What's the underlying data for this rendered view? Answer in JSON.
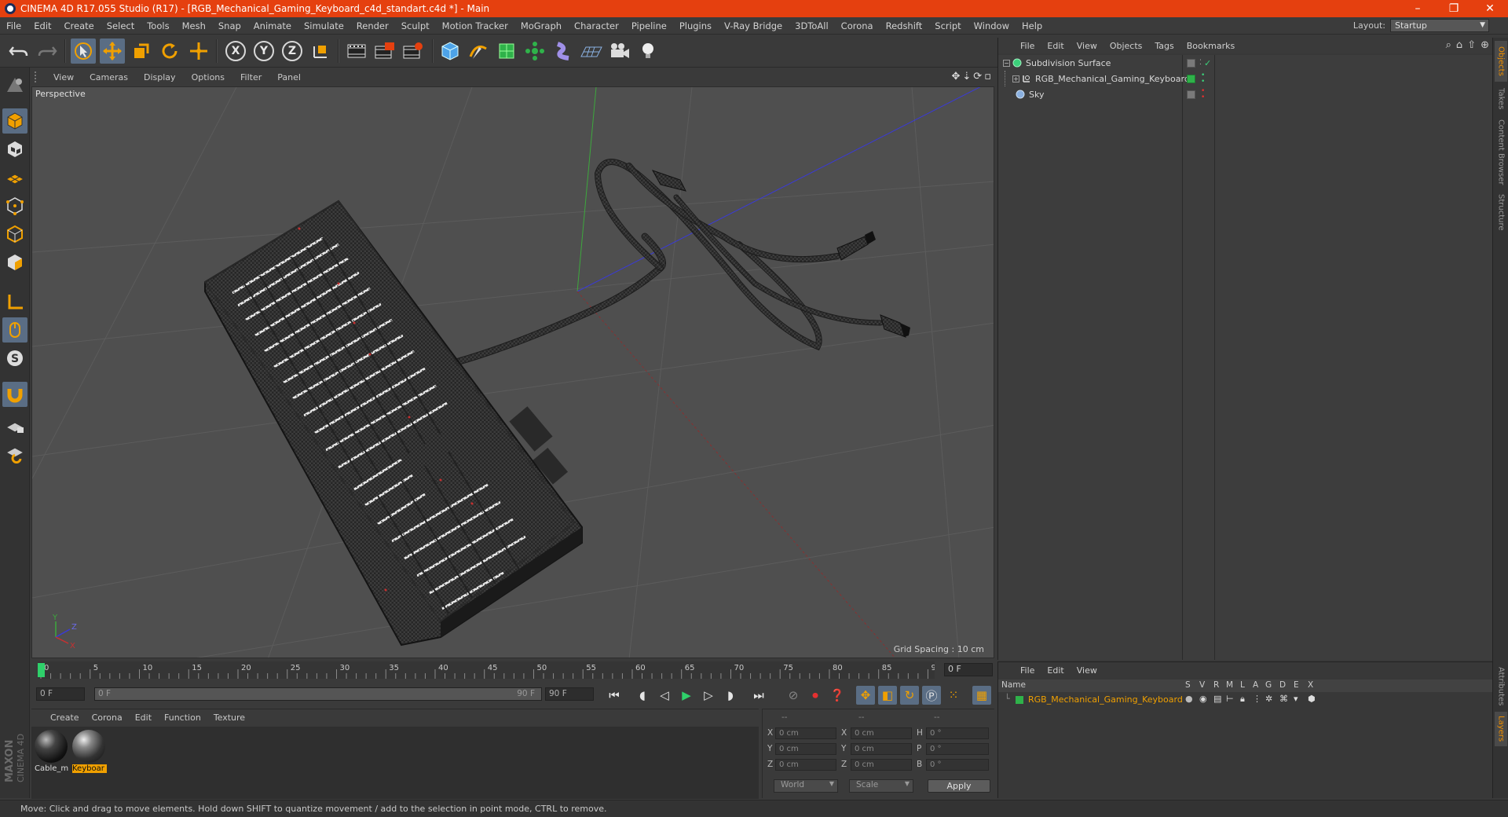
{
  "window": {
    "title": "CINEMA 4D R17.055 Studio (R17) - [RGB_Mechanical_Gaming_Keyboard_c4d_standart.c4d *] - Main",
    "controls": [
      "–",
      "❐",
      "✕"
    ]
  },
  "menubar": {
    "items": [
      "File",
      "Edit",
      "Create",
      "Select",
      "Tools",
      "Mesh",
      "Snap",
      "Animate",
      "Simulate",
      "Render",
      "Sculpt",
      "Motion Tracker",
      "MoGraph",
      "Character",
      "Pipeline",
      "Plugins",
      "V-Ray Bridge",
      "3DToAll",
      "Corona",
      "Redshift",
      "Script",
      "Window",
      "Help"
    ],
    "layout_label": "Layout:",
    "layout_value": "Startup"
  },
  "toolbar": {
    "axis_x": "X",
    "axis_y": "Y",
    "axis_z": "Z",
    "icons": [
      "undo-icon",
      "redo-icon",
      "select-icon",
      "move-icon",
      "scale-icon",
      "rotate-icon",
      "live-select-icon",
      "x-axis-icon",
      "y-axis-icon",
      "z-axis-icon",
      "world-coord-icon",
      "render-view-icon",
      "render-picture-viewer-icon",
      "render-settings-icon",
      "cube-icon",
      "spline-pen-icon",
      "subdivision-icon",
      "array-icon",
      "deformer-icon",
      "floor-icon",
      "camera-icon",
      "light-icon"
    ]
  },
  "viewport": {
    "menu": [
      "View",
      "Cameras",
      "Display",
      "Options",
      "Filter",
      "Panel"
    ],
    "label": "Perspective",
    "grid_spacing": "Grid Spacing : 10 cm",
    "axis_labels": {
      "y": "Y",
      "z": "Z",
      "x": "X"
    }
  },
  "timeline": {
    "ticks": [
      "0",
      "5",
      "10",
      "15",
      "20",
      "25",
      "30",
      "35",
      "40",
      "45",
      "50",
      "55",
      "60",
      "65",
      "70",
      "75",
      "80",
      "85",
      "90"
    ],
    "current_frame": "0 F",
    "start_frame": "0 F",
    "range_start": "0 F",
    "range_end": "90 F",
    "end_frame": "90 F"
  },
  "materials": {
    "menu": [
      "Create",
      "Corona",
      "Edit",
      "Function",
      "Texture"
    ],
    "items": [
      {
        "name": "Cable_m",
        "selected": false
      },
      {
        "name": "Keyboar",
        "selected": true
      }
    ]
  },
  "coordinates": {
    "header": [
      "--",
      "--",
      "--"
    ],
    "rows": [
      {
        "a": "X",
        "v1": "0 cm",
        "b": "X",
        "v2": "0 cm",
        "c": "H",
        "v3": "0 °"
      },
      {
        "a": "Y",
        "v1": "0 cm",
        "b": "Y",
        "v2": "0 cm",
        "c": "P",
        "v3": "0 °"
      },
      {
        "a": "Z",
        "v1": "0 cm",
        "b": "Z",
        "v2": "0 cm",
        "c": "B",
        "v3": "0 °"
      }
    ],
    "mode": "World",
    "transform": "Scale",
    "apply": "Apply"
  },
  "object_manager": {
    "menu": [
      "File",
      "Edit",
      "View",
      "Objects",
      "Tags",
      "Bookmarks"
    ],
    "objects": [
      {
        "name": "Subdivision Surface",
        "icon": "subdivision-icon",
        "color": "#3bd07a"
      },
      {
        "name": "RGB_Mechanical_Gaming_Keyboard",
        "icon": "null-object-icon",
        "color": "#dddddd"
      },
      {
        "name": "Sky",
        "icon": "sky-icon",
        "color": "#8ab0e0"
      }
    ]
  },
  "layer_manager": {
    "menu": [
      "File",
      "Edit",
      "View"
    ],
    "header_name": "Name",
    "columns": [
      "S",
      "V",
      "R",
      "M",
      "L",
      "A",
      "G",
      "D",
      "E",
      "X"
    ],
    "layers": [
      {
        "name": "RGB_Mechanical_Gaming_Keyboard",
        "color": "#2fb24a"
      }
    ]
  },
  "right_tabs": [
    "Objects",
    "Takes",
    "Content Browser",
    "Structure",
    "Attributes",
    "Layers"
  ],
  "status": "Move: Click and drag to move elements. Hold down SHIFT to quantize movement / add to the selection in point mode, CTRL to remove.",
  "brand": {
    "maxon": "MAXON",
    "cinema": "CINEMA 4D"
  },
  "colors": {
    "accent": "#e5400f",
    "selection": "#f0a000",
    "active_tool": "#5a6d84"
  }
}
